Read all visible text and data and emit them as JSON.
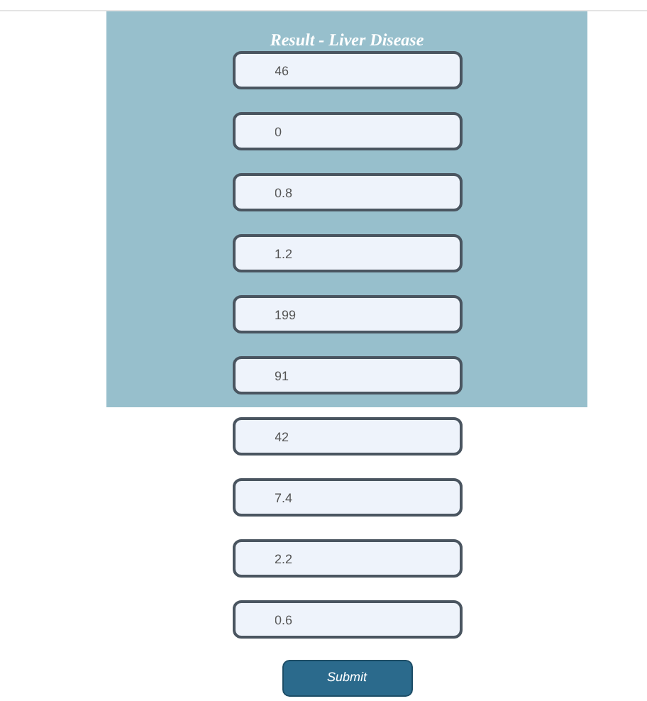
{
  "panel": {
    "title": "Result - Liver Disease",
    "fields": [
      {
        "value": "46"
      },
      {
        "value": "0"
      },
      {
        "value": "0.8"
      },
      {
        "value": "1.2"
      },
      {
        "value": "199"
      },
      {
        "value": "91"
      }
    ]
  },
  "fields": [
    {
      "value": "42"
    },
    {
      "value": "7.4"
    },
    {
      "value": "2.2"
    },
    {
      "value": "0.6"
    }
  ],
  "submit": {
    "label": "Submit"
  }
}
